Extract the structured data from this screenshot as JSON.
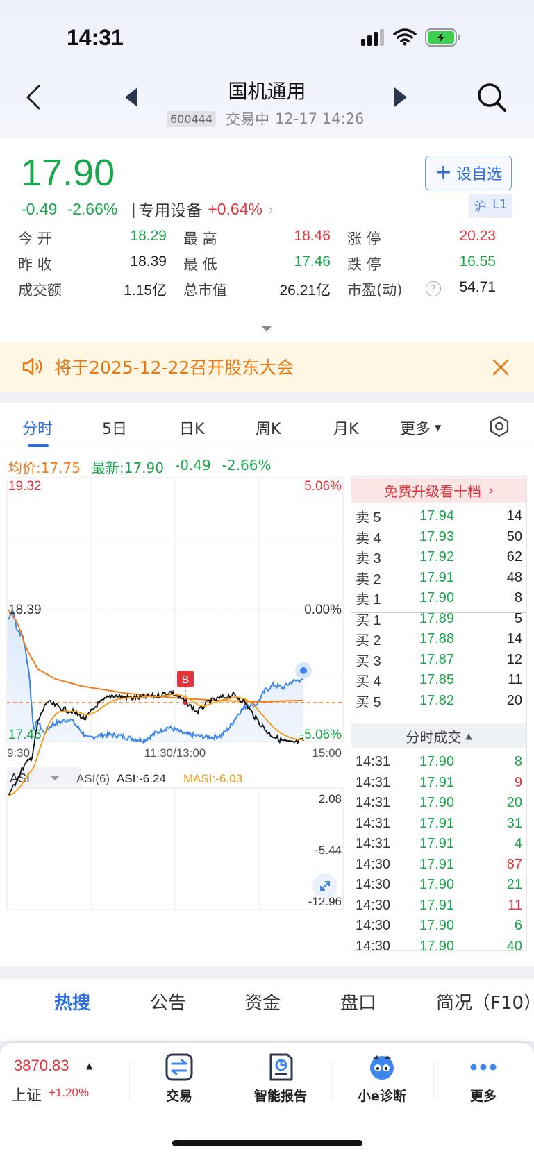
{
  "status": {
    "time": "14:31"
  },
  "nav": {
    "title": "国机通用",
    "code": "600444",
    "trade_status": "交易中",
    "datetime": "12-17 14:26"
  },
  "quote": {
    "price": "17.90",
    "change": "-0.49",
    "change_pct": "-2.66%",
    "sector": "专用设备",
    "sector_pct": "+0.64%",
    "watch_label": "设自选",
    "market_tag": "沪",
    "level_tag": "L1",
    "stats": [
      {
        "label": "今 开",
        "value": "18.29"
      },
      {
        "label": "最 高",
        "value": "18.46"
      },
      {
        "label": "涨 停",
        "value": "20.23"
      },
      {
        "label": "昨 收",
        "value": "18.39"
      },
      {
        "label": "最 低",
        "value": "17.46"
      },
      {
        "label": "跌 停",
        "value": "16.55"
      },
      {
        "label": "成交额",
        "value": "1.15亿"
      },
      {
        "label": "总市值",
        "value": "26.21亿"
      },
      {
        "label": "市盈(动)",
        "value": "54.71"
      }
    ]
  },
  "notice": {
    "text": "将于2025-12-22召开股东大会"
  },
  "chart_tabs": [
    "分时",
    "5日",
    "日K",
    "周K",
    "月K",
    "更多"
  ],
  "intraday": {
    "avg_label": "均价:17.75",
    "latest_label": "最新:17.90",
    "change": "-0.49",
    "change_pct": "-2.66%",
    "y_top": "19.32",
    "y_mid": "18.39",
    "y_bottom": "17.46",
    "pct_top": "5.06%",
    "pct_mid": "0.00%",
    "pct_bottom": "-5.06%",
    "x_start": "9:30",
    "x_mid": "11:30/13:00",
    "x_end": "15:00",
    "marker": "B"
  },
  "asi": {
    "selector": "ASI",
    "param": "ASI(6)",
    "asi_label": "ASI:-6.24",
    "masi_label": "MASI:-6.03",
    "y_top": "2.08",
    "y_mid": "-5.44",
    "y_bottom": "-12.96"
  },
  "orderbook": {
    "upgrade_label": "免费升级看十档",
    "asks": [
      {
        "label": "卖 5",
        "price": "17.94",
        "vol": "14"
      },
      {
        "label": "卖 4",
        "price": "17.93",
        "vol": "50"
      },
      {
        "label": "卖 3",
        "price": "17.92",
        "vol": "62"
      },
      {
        "label": "卖 2",
        "price": "17.91",
        "vol": "48"
      },
      {
        "label": "卖 1",
        "price": "17.90",
        "vol": "8"
      }
    ],
    "bids": [
      {
        "label": "买 1",
        "price": "17.89",
        "vol": "5"
      },
      {
        "label": "买 2",
        "price": "17.88",
        "vol": "14"
      },
      {
        "label": "买 3",
        "price": "17.87",
        "vol": "12"
      },
      {
        "label": "买 4",
        "price": "17.85",
        "vol": "11"
      },
      {
        "label": "买 5",
        "price": "17.82",
        "vol": "20"
      }
    ],
    "trades_label": "分时成交",
    "trades": [
      {
        "time": "14:31",
        "price": "17.90",
        "vol": "8",
        "side": "green"
      },
      {
        "time": "14:31",
        "price": "17.91",
        "vol": "9",
        "side": "red"
      },
      {
        "time": "14:31",
        "price": "17.90",
        "vol": "20",
        "side": "green"
      },
      {
        "time": "14:31",
        "price": "17.91",
        "vol": "31",
        "side": "green"
      },
      {
        "time": "14:31",
        "price": "17.91",
        "vol": "4",
        "side": "green"
      },
      {
        "time": "14:30",
        "price": "17.91",
        "vol": "87",
        "side": "red"
      },
      {
        "time": "14:30",
        "price": "17.90",
        "vol": "21",
        "side": "green"
      },
      {
        "time": "14:30",
        "price": "17.91",
        "vol": "11",
        "side": "red"
      },
      {
        "time": "14:30",
        "price": "17.90",
        "vol": "6",
        "side": "green"
      },
      {
        "time": "14:30",
        "price": "17.90",
        "vol": "40",
        "side": "green"
      }
    ]
  },
  "bottom_tabs": [
    "热搜",
    "公告",
    "资金",
    "盘口",
    "简况（F10）"
  ],
  "toolbar": {
    "index_value": "3870.83",
    "index_name": "上证",
    "index_pct": "+1.20%",
    "items": [
      "交易",
      "智能报告",
      "小e诊断",
      "更多"
    ]
  },
  "colors": {
    "up": "#e2343c",
    "down": "#1aa64b",
    "accent": "#2d6fe0",
    "avg_line": "#f07a1c"
  }
}
